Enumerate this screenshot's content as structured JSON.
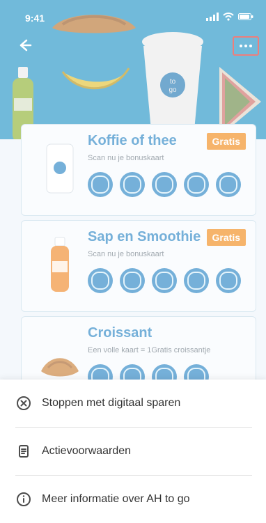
{
  "status": {
    "time": "9:41"
  },
  "header": {
    "back_icon": "arrow-left-icon",
    "more_icon": "more-dots-icon"
  },
  "cards": [
    {
      "title": "Koffie of thee",
      "subtitle": "Scan nu je bonuskaart",
      "badge": "Gratis",
      "stamps_count": 5,
      "product_icon": "coffee-cup-icon"
    },
    {
      "title": "Sap en Smoothie",
      "subtitle": "Scan nu je bonuskaart",
      "badge": "Gratis",
      "stamps_count": 5,
      "product_icon": "juice-bottle-icon"
    },
    {
      "title": "Croissant",
      "subtitle": "Een volle kaart = 1Gratis croissantje",
      "badge": "",
      "stamps_count": 4,
      "product_icon": "croissant-icon"
    }
  ],
  "sheet": {
    "items": [
      {
        "label": "Stoppen met digitaal sparen",
        "icon": "close-circle-icon"
      },
      {
        "label": "Actievoorwaarden",
        "icon": "document-icon"
      },
      {
        "label": "Meer informatie over AH to go",
        "icon": "info-icon"
      }
    ]
  },
  "colors": {
    "hero_bg": "#2aa3d8",
    "accent_blue": "#2b86c5",
    "badge_orange": "#f28c1c",
    "highlight_red": "#e53935"
  }
}
